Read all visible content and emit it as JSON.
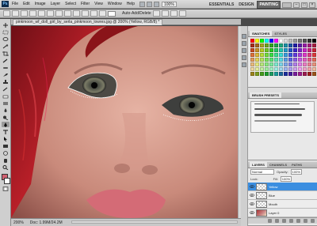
{
  "menubar": {
    "logo": "Ps",
    "items": [
      "File",
      "Edit",
      "Image",
      "Layer",
      "Select",
      "Filter",
      "View",
      "Window",
      "Help"
    ],
    "zoom": "100%",
    "workspaces": {
      "essentials": "ESSENTIALS",
      "design": "DESIGN",
      "painting": "PAINTING"
    }
  },
  "options": {
    "text": "Auto-Add/Delete"
  },
  "document": {
    "tab": "pinkmoon_wf_doll_girl_by_serla_pinkmoon_lowres.jpg @ 200% (Yellow, RGB/8) *"
  },
  "status": {
    "zoom": "200%",
    "doc": "Doc: 1.99M/24.2M"
  },
  "panels": {
    "swatches": {
      "tab1": "SWATCHES",
      "tab2": "STYLES"
    },
    "brush": {
      "tab": "BRUSH PRESETS"
    },
    "layers": {
      "tab1": "LAYERS",
      "tab2": "CHANNELS",
      "tab3": "PATHS",
      "blend": "Normal",
      "opacity_label": "Opacity:",
      "opacity": "100%",
      "fill_label": "Fill:",
      "fill": "100%",
      "lock": "Lock:"
    }
  },
  "layers": [
    {
      "name": "Yellow",
      "selected": true
    },
    {
      "name": "Blue",
      "selected": false
    },
    {
      "name": "Mouth",
      "selected": false
    },
    {
      "name": "Layer 0",
      "selected": false
    }
  ],
  "colors": {
    "foreground": "#d06070",
    "background": "#ffffff",
    "accent": "#3b8ee0"
  }
}
